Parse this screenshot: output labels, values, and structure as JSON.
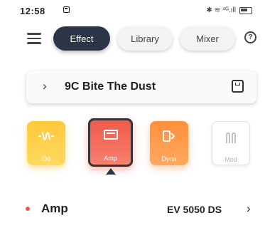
{
  "status_bar": {
    "time": "12:58",
    "right_text": "✱ ≋ ⁴ᴳ.ıll"
  },
  "tabs": [
    {
      "label": "Effect",
      "active": true
    },
    {
      "label": "Library",
      "active": false
    },
    {
      "label": "Mixer",
      "active": false
    }
  ],
  "help_icon": "?",
  "preset": {
    "chevron": "›",
    "name": "9C Bite The Dust"
  },
  "slots": [
    {
      "label": "Od",
      "icon": "od-icon",
      "color": "#ffc93a"
    },
    {
      "label": "Amp",
      "icon": "amp-icon",
      "color": "#f05a4a",
      "selected": true
    },
    {
      "label": "Dyna",
      "icon": "dyna-icon",
      "color": "#ff8f3b"
    },
    {
      "label": "Mod",
      "icon": "mod-icon",
      "color": "#ffffff"
    }
  ],
  "selected_module": {
    "title": "Amp",
    "model": "EV 5050 DS",
    "arrow": "›"
  },
  "colors": {
    "active_tab": "#2c3547",
    "amp_red": "#f05a4a"
  }
}
